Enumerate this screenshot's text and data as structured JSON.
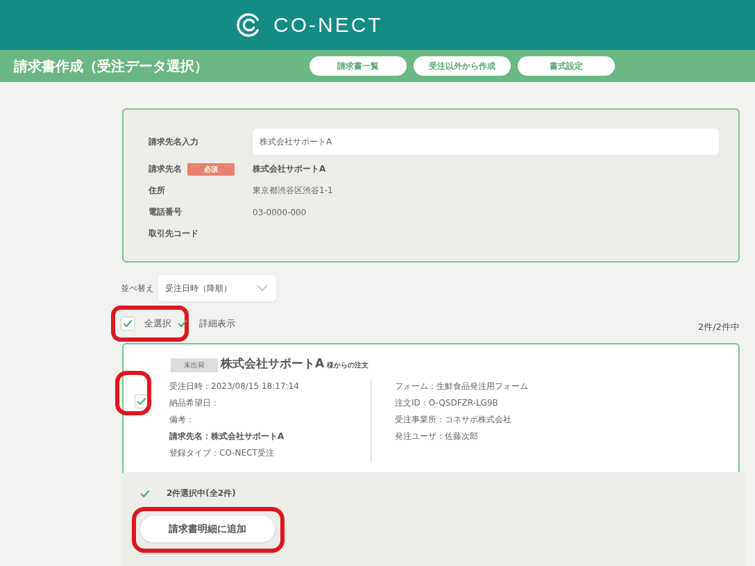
{
  "header": {
    "logo_text": "CO-NECT"
  },
  "title_bar": {
    "title": "請求書作成（受注データ選択）",
    "buttons": [
      "請求書一覧",
      "受注以外から作成",
      "書式設定"
    ]
  },
  "customer": {
    "input_label": "請求先名入力",
    "input_value": "株式会社サポートA",
    "fields": [
      {
        "label": "請求先名",
        "badge": "必須",
        "value": "株式会社サポートA",
        "bold": true
      },
      {
        "label": "住所",
        "value": "東京都渋谷区渋谷1-1",
        "bold": false
      },
      {
        "label": "電話番号",
        "value": "03-0000-000",
        "bold": false
      },
      {
        "label": "取引先コード"
      }
    ]
  },
  "sort": {
    "label": "並べ替え",
    "value": "受注日時（降順）"
  },
  "options": [
    {
      "label": "全選択",
      "checked": true,
      "highlighted": true
    },
    {
      "label": "詳細表示",
      "checked": true,
      "highlighted": false
    }
  ],
  "count": "2件/2件中",
  "orders": [
    {
      "status": "未出荷",
      "customer": "株式会社サポートA",
      "suffix": "様からの注文",
      "checked": true,
      "highlighted": true,
      "left": [
        {
          "text": "受注日時：2023/08/15 18:17:14",
          "bold": false
        },
        {
          "text": "納品希望日：",
          "bold": false
        },
        {
          "text": "備考：",
          "bold": false
        },
        {
          "text": "請求先名：株式会社サポートA",
          "bold": true
        },
        {
          "text": "登録タイプ：CO-NECT受注",
          "bold": false
        }
      ],
      "right": [
        "フォーム：生鮮食品発注用フォーム",
        "注文ID：O-QSDFZR-LG9B",
        "受注事業所：コネサポ株式会社",
        "発注ユーザ：佐藤次郎"
      ]
    }
  ],
  "footer": {
    "selection": "2件選択中(全2件)",
    "button": "請求書明細に追加",
    "highlighted": true
  }
}
